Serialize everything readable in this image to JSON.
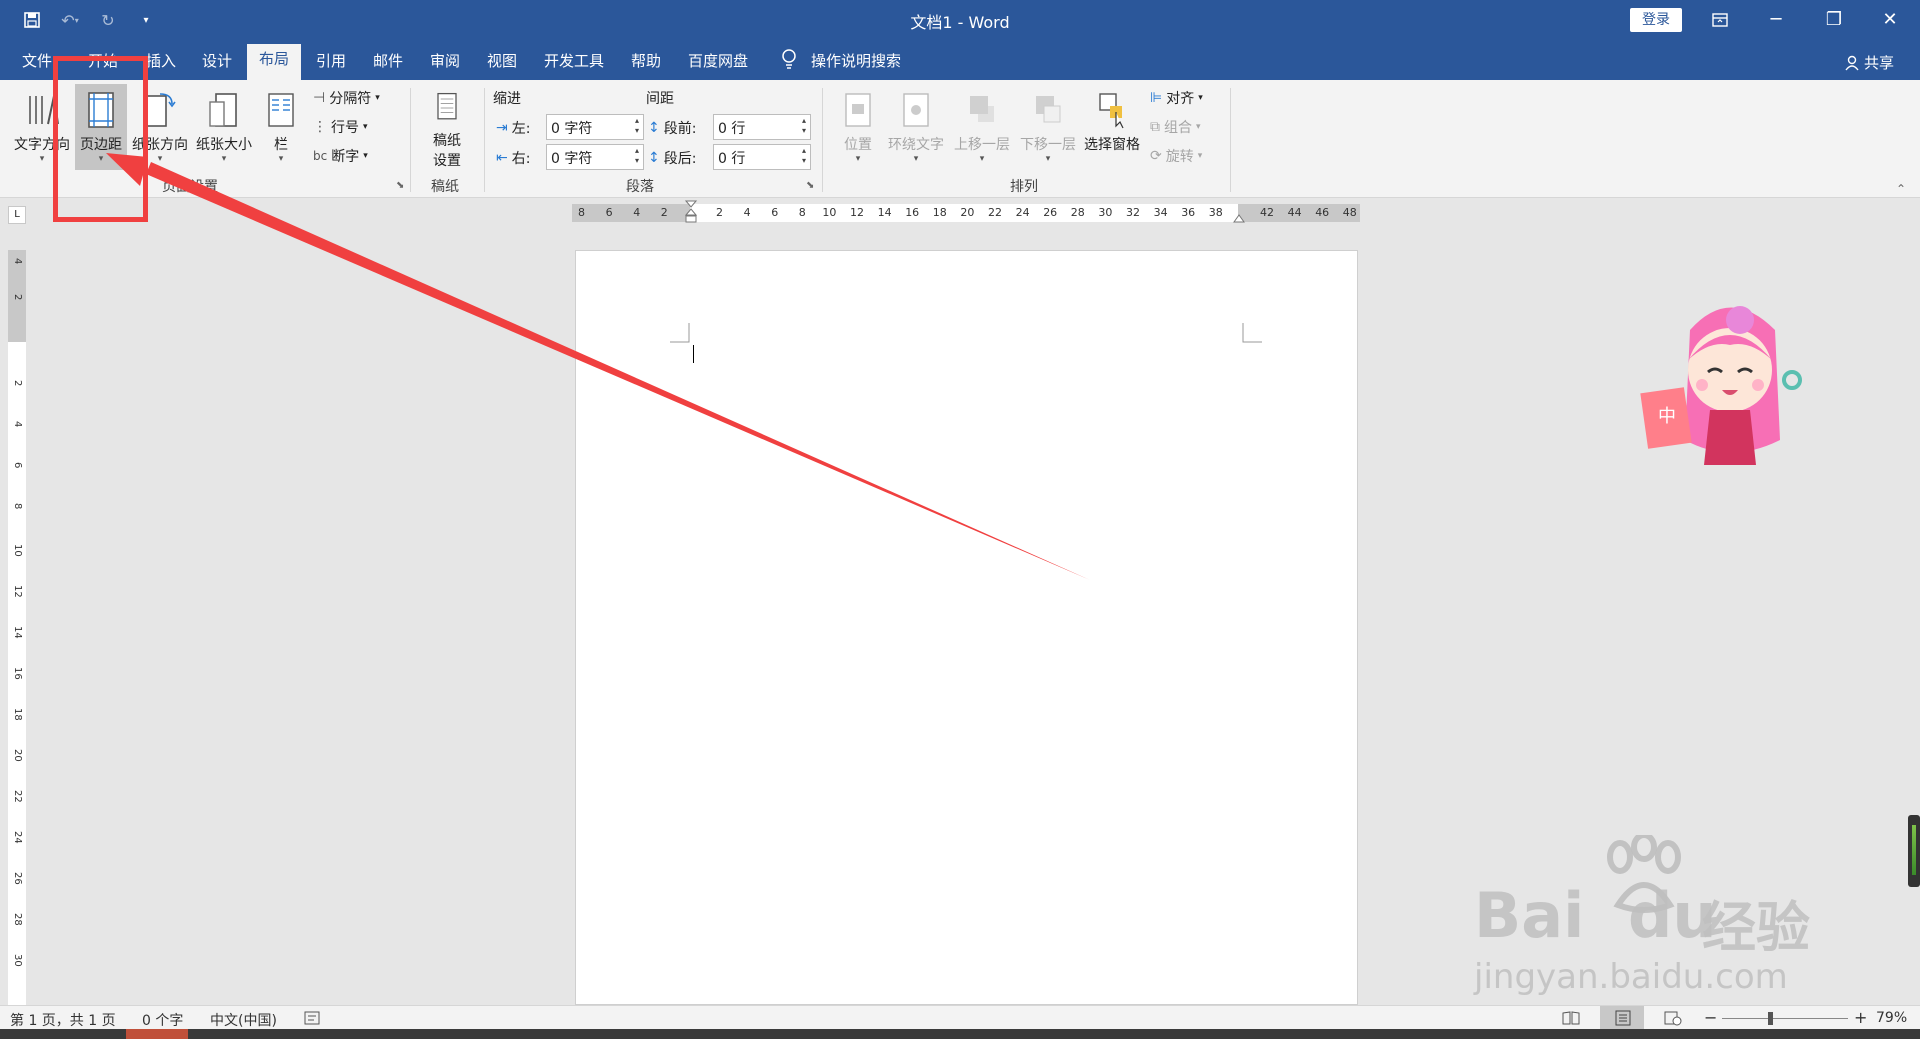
{
  "window": {
    "title": "文档1  -  Word",
    "login_label": "登录",
    "controls": {
      "ribbon_display": "ribbon-display-icon",
      "minimize": "─",
      "restore": "❐",
      "close": "✕"
    }
  },
  "tabs": {
    "items": [
      "文件",
      "开始",
      "插入",
      "设计",
      "布局",
      "引用",
      "邮件",
      "审阅",
      "视图",
      "开发工具",
      "帮助",
      "百度网盘"
    ],
    "active": "布局",
    "tell_me": "操作说明搜索",
    "share": "共享"
  },
  "ribbon": {
    "page_setup": {
      "text_direction": "文字方向",
      "margins": "页边距",
      "orientation": "纸张方向",
      "size": "纸张大小",
      "columns": "栏",
      "breaks": "分隔符",
      "line_numbers": "行号",
      "hyphenation": "断字",
      "group_label": "页面设置"
    },
    "manuscript": {
      "button_line1": "稿纸",
      "button_line2": "设置",
      "group_label": "稿纸"
    },
    "paragraph": {
      "indent_label": "缩进",
      "spacing_label": "间距",
      "left_label": "左:",
      "right_label": "右:",
      "left_value": "0 字符",
      "right_value": "0 字符",
      "before_label": "段前:",
      "after_label": "段后:",
      "before_value": "0 行",
      "after_value": "0 行",
      "group_label": "段落"
    },
    "arrange": {
      "position": "位置",
      "wrap_text": "环绕文字",
      "bring_forward": "上移一层",
      "send_backward": "下移一层",
      "selection_pane": "选择窗格",
      "align": "对齐",
      "group": "组合",
      "rotate": "旋转",
      "group_label": "排列"
    }
  },
  "ruler": {
    "corner": "L",
    "left_ticks": [
      "8",
      "6",
      "4",
      "2"
    ],
    "ticks": [
      "2",
      "4",
      "6",
      "8",
      "10",
      "12",
      "14",
      "16",
      "18",
      "20",
      "22",
      "24",
      "26",
      "28",
      "30",
      "32",
      "34",
      "36",
      "38"
    ],
    "right_ticks": [
      "42",
      "44",
      "46",
      "48"
    ],
    "v_top_ticks": [
      "4",
      "2"
    ],
    "v_ticks": [
      "2",
      "4",
      "6",
      "8",
      "10",
      "12",
      "14",
      "16",
      "18",
      "20",
      "22",
      "24",
      "26",
      "28",
      "30"
    ]
  },
  "status": {
    "page": "第 1 页，共 1 页",
    "words": "0 个字",
    "language": "中文(中国)",
    "zoom": "79%",
    "zoom_minus": "−",
    "zoom_plus": "+"
  },
  "watermark": {
    "brand_a": "Bai",
    "brand_b": "du",
    "brand_c": "经验",
    "url": "jingyan.baidu.com"
  },
  "colors": {
    "accent": "#2b579a",
    "annotation": "#f04040"
  }
}
